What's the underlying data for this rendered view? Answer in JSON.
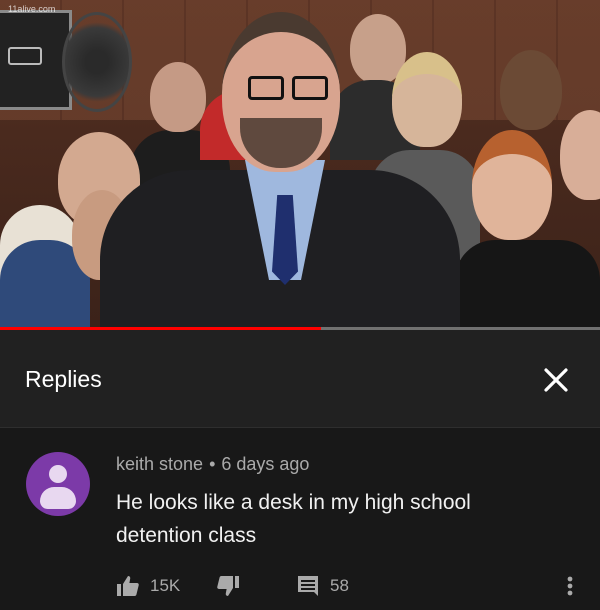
{
  "video": {
    "watermark": "11alive.com",
    "progress_fraction": 0.535
  },
  "replies_panel": {
    "title": "Replies",
    "close_icon": "close-icon"
  },
  "comment": {
    "author": "keith stone",
    "separator": "•",
    "time": "6 days ago",
    "text": "He looks like a desk in my high school detention class",
    "likes": "15K",
    "replies": "58",
    "avatar_color": "#7c3aa8"
  },
  "colors": {
    "background": "#212121",
    "comment_background": "#181818",
    "progress": "#ff0000",
    "meta_text": "#aaaaaa"
  }
}
